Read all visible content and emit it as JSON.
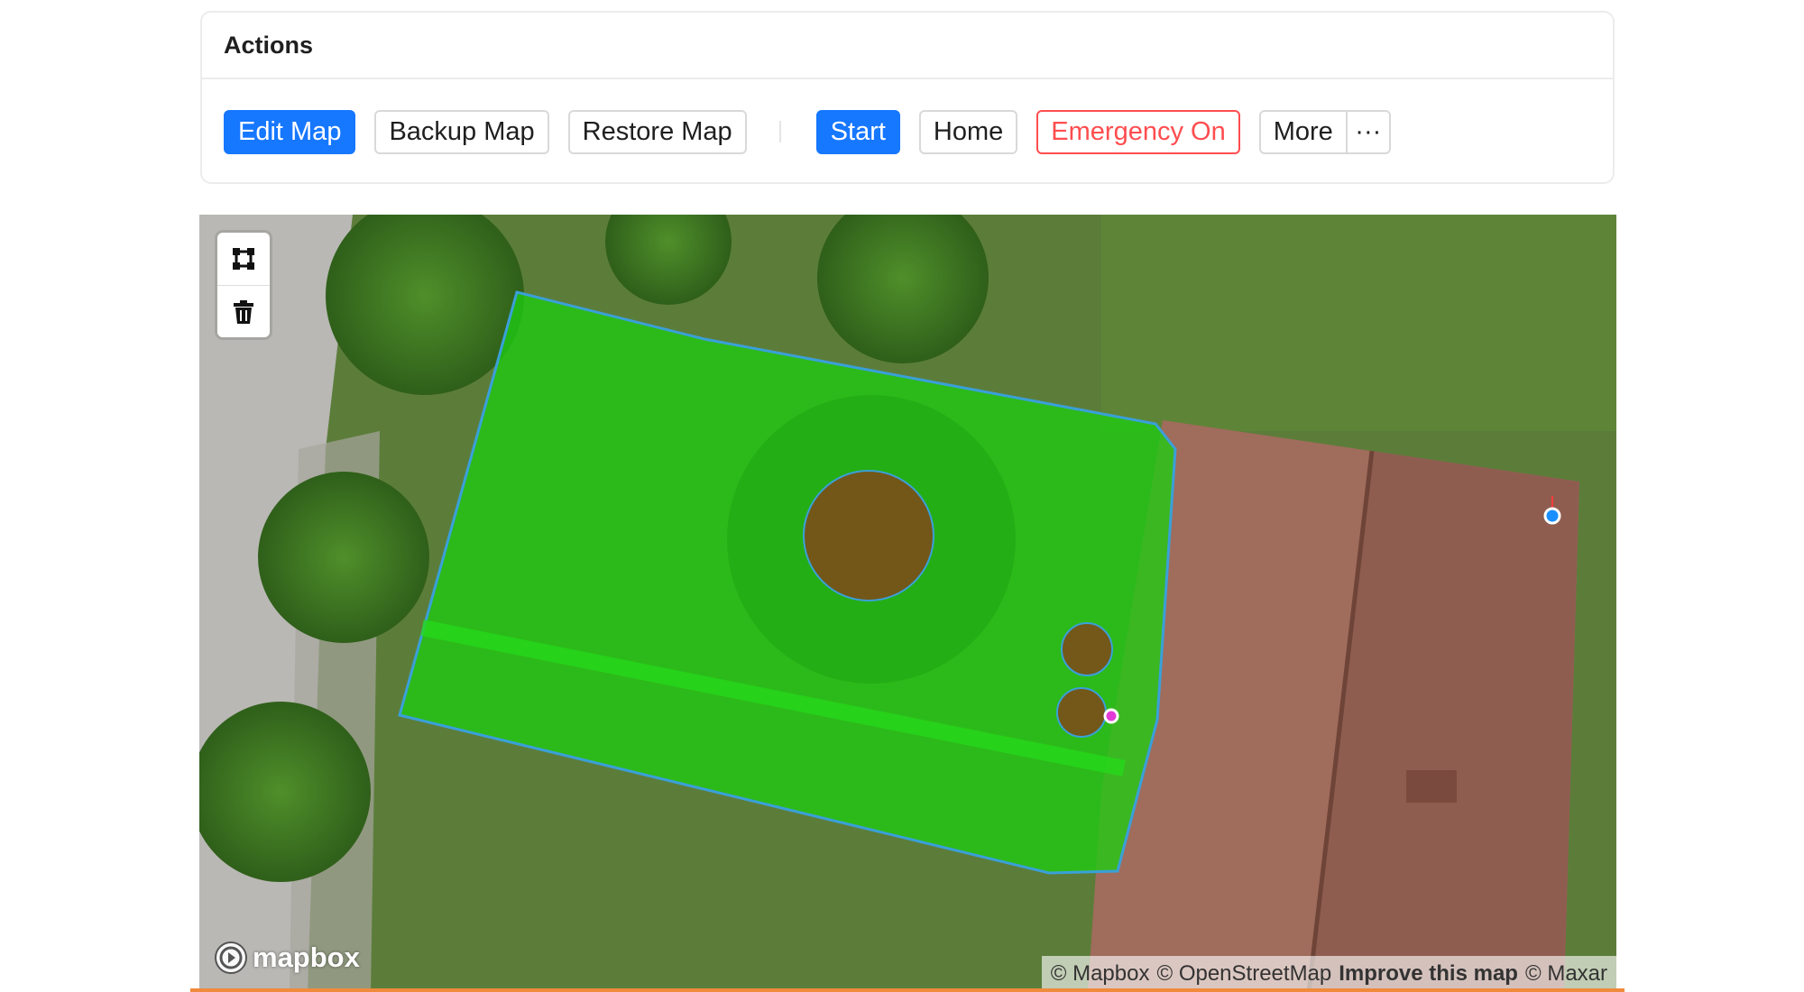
{
  "actions": {
    "title": "Actions",
    "edit_map": "Edit Map",
    "backup_map": "Backup Map",
    "restore_map": "Restore Map",
    "start": "Start",
    "home": "Home",
    "emergency": "Emergency On",
    "more": "More",
    "more_menu": "···"
  },
  "map": {
    "draw_tools": [
      "polygon-icon",
      "trash-icon"
    ],
    "logo_text": "mapbox",
    "attribution": {
      "mapbox": "© Mapbox",
      "osm": "© OpenStreetMap",
      "improve": "Improve this map",
      "maxar": "© Maxar"
    }
  },
  "colors": {
    "primary": "#1677ff",
    "danger": "#ff4d4f",
    "area_fill": "#1fcc12",
    "area_outline": "#3aa0d8",
    "obstacle": "#7a4f19"
  }
}
